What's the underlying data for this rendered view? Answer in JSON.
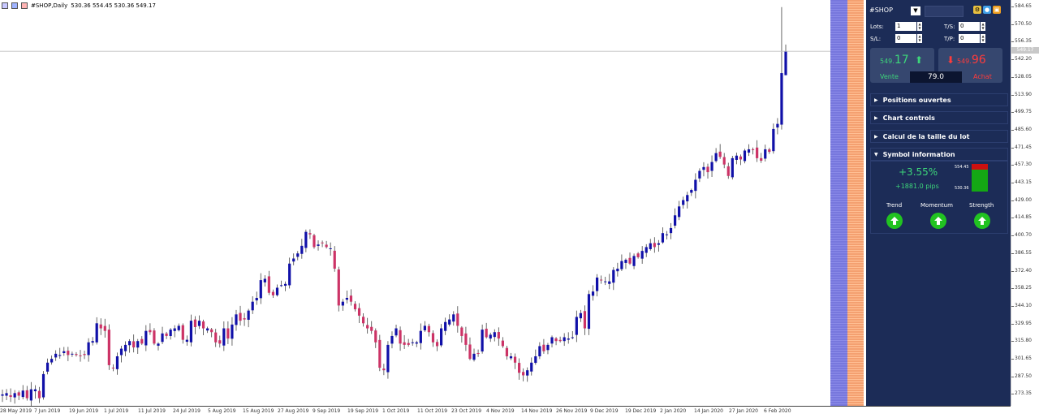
{
  "chart": {
    "header": {
      "symbol": "#SHOP,Daily",
      "ohlc": "530.36 554.45 530.36 549.17"
    },
    "price_axis": [
      "584.65",
      "570.50",
      "556.35",
      "542.20",
      "528.05",
      "513.90",
      "499.75",
      "485.60",
      "471.45",
      "457.30",
      "443.15",
      "429.00",
      "414.85",
      "400.70",
      "386.55",
      "372.40",
      "358.25",
      "344.10",
      "329.95",
      "315.80",
      "301.65",
      "287.50",
      "273.35"
    ],
    "last_price_tag": "549.17",
    "date_axis": [
      "28 May 2019",
      "7 Jun 2019",
      "19 Jun 2019",
      "1 Jul 2019",
      "11 Jul 2019",
      "24 Jul 2019",
      "5 Aug 2019",
      "15 Aug 2019",
      "27 Aug 2019",
      "9 Sep 2019",
      "19 Sep 2019",
      "1 Oct 2019",
      "11 Oct 2019",
      "23 Oct 2019",
      "4 Nov 2019",
      "14 Nov 2019",
      "26 Nov 2019",
      "9 Dec 2019",
      "19 Dec 2019",
      "2 Jan 2020",
      "14 Jan 2020",
      "27 Jan 2020",
      "6 Feb 2020"
    ],
    "colors": {
      "bull": "#1010a8",
      "bear": "#cc3366",
      "wick": "#444444",
      "price_line": "#c0c0c0"
    }
  },
  "chart_data": {
    "type": "candlestick",
    "title": "#SHOP,Daily",
    "ylim": [
      270,
      587
    ],
    "closes": [
      279,
      280,
      277,
      280,
      278,
      282,
      276,
      283,
      283,
      276,
      295,
      304,
      307,
      311,
      310,
      313,
      310,
      311,
      310,
      309,
      310,
      320,
      321,
      335,
      331,
      329,
      302,
      300,
      309,
      315,
      318,
      321,
      316,
      321,
      319,
      329,
      328,
      319,
      319,
      327,
      325,
      330,
      331,
      333,
      322,
      322,
      337,
      332,
      337,
      331,
      331,
      328,
      320,
      319,
      331,
      323,
      334,
      342,
      337,
      338,
      345,
      352,
      355,
      369,
      370,
      359,
      357,
      363,
      365,
      366,
      382,
      386,
      390,
      396,
      407,
      405,
      395,
      397,
      398,
      395,
      394,
      378,
      349,
      352,
      355,
      352,
      346,
      341,
      335,
      331,
      329,
      320,
      300,
      298,
      318,
      325,
      331,
      319,
      318,
      318,
      320,
      320,
      329,
      333,
      328,
      320,
      317,
      331,
      336,
      338,
      342,
      333,
      325,
      318,
      307,
      311,
      311,
      330,
      324,
      326,
      328,
      323,
      317,
      309,
      309,
      304,
      296,
      294,
      298,
      304,
      309,
      317,
      313,
      318,
      324,
      321,
      321,
      324,
      323,
      324,
      340,
      343,
      331,
      358,
      360,
      371,
      369,
      368,
      368,
      377,
      378,
      384,
      385,
      382,
      388,
      387,
      392,
      395,
      398,
      395,
      398,
      406,
      405,
      410,
      420,
      427,
      432,
      436,
      440,
      448,
      455,
      458,
      454,
      462,
      469,
      466,
      460,
      451,
      465,
      467,
      464,
      471,
      472,
      472,
      465,
      463,
      472,
      470,
      488,
      492,
      532,
      549
    ],
    "high": 584,
    "low": 273
  },
  "panel": {
    "symbol": "#SHOP",
    "lots_label": "Lots:",
    "lots_value": "1",
    "ts_label": "T/S:",
    "ts_value": "0",
    "sl_label": "S/L:",
    "sl_value": "0",
    "tp_label": "T/P:",
    "tp_value": "0",
    "sell_price_main": "549.",
    "sell_price_big": "17",
    "buy_price_main": "549.",
    "buy_price_big": "96",
    "sell_label": "Vente",
    "buy_label": "Achat",
    "spread": "79.0",
    "sections": [
      "Positions ouvertes",
      "Chart controls",
      "Calcul de la taille du lot",
      "Symbol information"
    ],
    "symbol_info": {
      "pct": "+3.55%",
      "pips": "+1881.0 pips",
      "high": "554.45",
      "low": "530.36",
      "indicators": [
        "Trend",
        "Momentum",
        "Strength"
      ]
    }
  }
}
